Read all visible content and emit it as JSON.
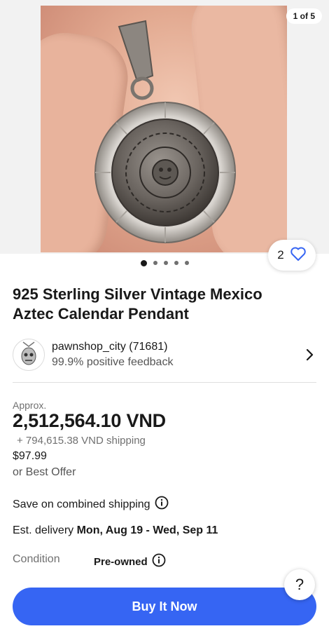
{
  "gallery": {
    "counter": "1 of 5",
    "watch_count": "2",
    "total_images": 5,
    "active_index": 0
  },
  "listing": {
    "title": "925 Sterling Silver Vintage Mexico Aztec Calendar Pendant"
  },
  "seller": {
    "name": "pawnshop_city (71681)",
    "feedback": "99.9% positive feedback"
  },
  "price": {
    "approx_label": "Approx.",
    "amount": "2,512,564.10 VND",
    "shipping": "+ 794,615.38 VND shipping",
    "original": "$97.99",
    "offer": "or Best Offer"
  },
  "shipping_info": {
    "combined": "Save on combined shipping",
    "delivery_label": "Est. delivery",
    "delivery_dates": "Mon, Aug 19 - Wed, Sep 11"
  },
  "condition": {
    "label": "Condition",
    "value": "Pre-owned"
  },
  "actions": {
    "help": "?",
    "buy_now": "Buy It Now"
  },
  "colors": {
    "primary": "#3665f3",
    "text": "#191919",
    "muted": "#707070"
  }
}
